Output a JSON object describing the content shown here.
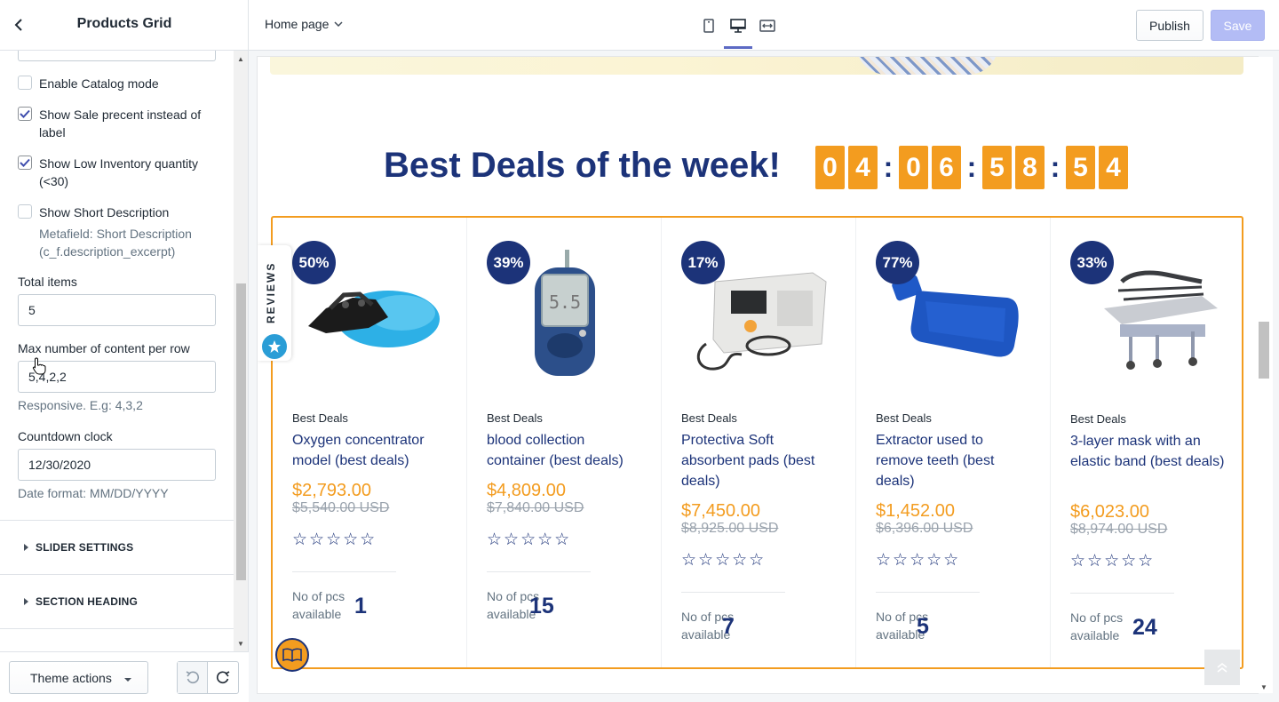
{
  "sidebar": {
    "title": "Products Grid",
    "checkboxes": [
      {
        "label": "Enable Catalog mode",
        "checked": false
      },
      {
        "label": "Show Sale precent instead of label",
        "checked": true
      },
      {
        "label": "Show Low Inventory quantity (<30)",
        "checked": true
      },
      {
        "label": "Show Short Description",
        "checked": false
      }
    ],
    "short_description_help": "Metafield: Short Description (c_f.description_excerpt)",
    "total_items_label": "Total items",
    "total_items_value": "5",
    "max_content_label": "Max number of content per row",
    "max_content_value": "5,4,2,2",
    "max_content_help": "Responsive. E.g: 4,3,2",
    "countdown_label": "Countdown clock",
    "countdown_value": "12/30/2020",
    "countdown_help": "Date format: MM/DD/YYYY",
    "sections": [
      "SLIDER SETTINGS",
      "SECTION HEADING"
    ],
    "theme_actions_label": "Theme actions"
  },
  "topbar": {
    "page_select": "Home page",
    "publish_label": "Publish",
    "save_label": "Save",
    "active_view": "desktop"
  },
  "preview": {
    "heading": "Best Deals of the week!",
    "timer": [
      "0",
      "4",
      "0",
      "6",
      "5",
      "8",
      "5",
      "4"
    ],
    "reviews_tab": "REVIEWS",
    "availability_label": "No of pcs available",
    "products": [
      {
        "discount": "50%",
        "vendor": "Best Deals",
        "name": "Oxygen concentrator model (best deals)",
        "price": "$2,793.00",
        "old_price": "$5,540.00 USD",
        "stars": "☆☆☆☆☆",
        "qty": "1",
        "image": "shoe-covers"
      },
      {
        "discount": "39%",
        "vendor": "Best Deals",
        "name": "blood collection container (best deals)",
        "price": "$4,809.00",
        "old_price": "$7,840.00 USD",
        "stars": "☆☆☆☆☆",
        "qty": "15",
        "image": "glucose-meter"
      },
      {
        "discount": "17%",
        "vendor": "Best Deals",
        "name": "Protectiva Soft absorbent pads (best deals)",
        "price": "$7,450.00",
        "old_price": "$8,925.00 USD",
        "stars": "☆☆☆☆☆",
        "qty": "7",
        "image": "defibrillator"
      },
      {
        "discount": "77%",
        "vendor": "Best Deals",
        "name": "Extractor used to remove teeth (best deals)",
        "price": "$1,452.00",
        "old_price": "$6,396.00 USD",
        "stars": "☆☆☆☆☆",
        "qty": "5",
        "image": "hot-water-bottle"
      },
      {
        "discount": "33%",
        "vendor": "Best Deals",
        "name": "3-layer mask with an elastic band (best deals)",
        "price": "$6,023.00",
        "old_price": "$8,974.00 USD",
        "stars": "☆☆☆☆☆",
        "qty": "24",
        "image": "hospital-stretcher"
      }
    ]
  },
  "colors": {
    "accent": "#f39c1f",
    "navy": "#1c3379",
    "primary_button": "#b3bcf5"
  }
}
